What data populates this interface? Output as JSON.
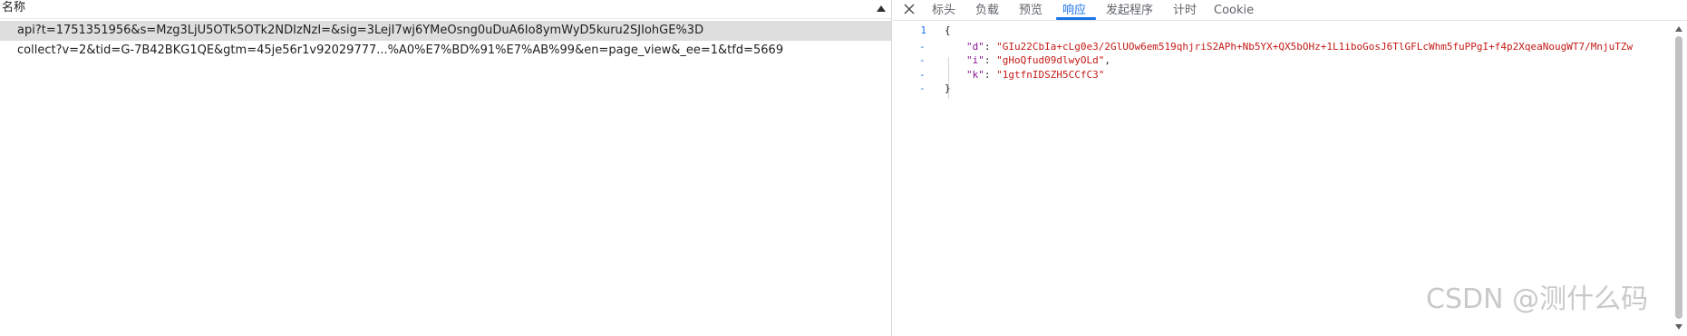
{
  "colors": {
    "accent": "#1a73e8",
    "selected_row": "#dedede",
    "json_key": "#881391",
    "json_string": "#c41a16",
    "watermark": "#b8b8b8"
  },
  "request_list": {
    "column_header": "名称",
    "sort_icon": "sort-ascending-icon",
    "rows": [
      {
        "name": "api?t=1751351956&s=Mzg3LjU5OTk5OTk2NDIzNzI=&sig=3LejI7wj6YMeOsng0uDuA6Io8ymWyD5kuru2SJIohGE%3D",
        "selected": true
      },
      {
        "name": "collect?v=2&tid=G-7B42BKG1QE&gtm=45je56r1v92029777...%A0%E7%BD%91%E7%AB%99&en=page_view&_ee=1&tfd=5669",
        "selected": false
      }
    ]
  },
  "detail_panel": {
    "close_icon": "close-icon",
    "tabs": [
      {
        "label": "标头",
        "active": false
      },
      {
        "label": "负载",
        "active": false
      },
      {
        "label": "预览",
        "active": false
      },
      {
        "label": "响应",
        "active": true
      },
      {
        "label": "发起程序",
        "active": false
      },
      {
        "label": "计时",
        "active": false
      },
      {
        "label": "Cookie",
        "active": false
      }
    ],
    "response": {
      "line_number": "1",
      "fold_marker": "-",
      "open_brace": "{",
      "close_brace": "}",
      "fields": [
        {
          "key": "\"d\"",
          "value": "\"GIu22CbIa+cLg0e3/2GlUOw6em519qhjriS2APh+Nb5YX+QX5bOHz+1L1iboGosJ6TlGFLcWhm5fuPPgI+f4p2XqeaNougWT7/MnjuTZw",
          "trail": ""
        },
        {
          "key": "\"i\"",
          "value": "\"gHoQfud09dlwyOLd\"",
          "trail": ","
        },
        {
          "key": "\"k\"",
          "value": "\"1gtfnIDSZH5CCfC3\"",
          "trail": ""
        }
      ]
    }
  },
  "watermark": "CSDN @测什么码"
}
